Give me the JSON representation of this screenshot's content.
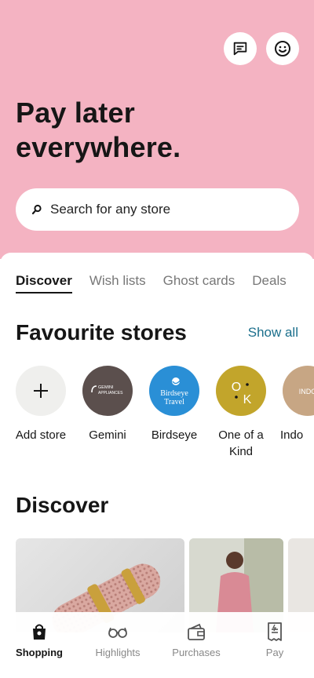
{
  "hero": {
    "title_line1": "Pay later",
    "title_line2": "everywhere.",
    "background": "#f4b3c2",
    "icons": [
      "chat-icon",
      "smiley-icon"
    ]
  },
  "search": {
    "placeholder": "Search for any store"
  },
  "tabs": [
    {
      "label": "Discover",
      "active": true
    },
    {
      "label": "Wish lists",
      "active": false
    },
    {
      "label": "Ghost cards",
      "active": false
    },
    {
      "label": "Deals",
      "active": false
    }
  ],
  "favourites": {
    "title": "Favourite stores",
    "show_all": "Show all",
    "stores": [
      {
        "name": "Add store",
        "icon": "plus-icon"
      },
      {
        "name": "Gemini",
        "logo_text": "GEMINI APPLIANCES"
      },
      {
        "name": "Birdseye",
        "logo_text": "Birdseye Travel"
      },
      {
        "name": "One of a Kind",
        "logo_text": "OK"
      },
      {
        "name": "Indo",
        "logo_text": "INDO"
      }
    ]
  },
  "discover": {
    "title": "Discover"
  },
  "tabbar": [
    {
      "label": "Shopping",
      "icon": "shopping-bag-icon",
      "active": true
    },
    {
      "label": "Highlights",
      "icon": "glasses-icon",
      "active": false
    },
    {
      "label": "Purchases",
      "icon": "wallet-icon",
      "active": false
    },
    {
      "label": "Pay",
      "icon": "receipt-icon",
      "active": false
    }
  ]
}
